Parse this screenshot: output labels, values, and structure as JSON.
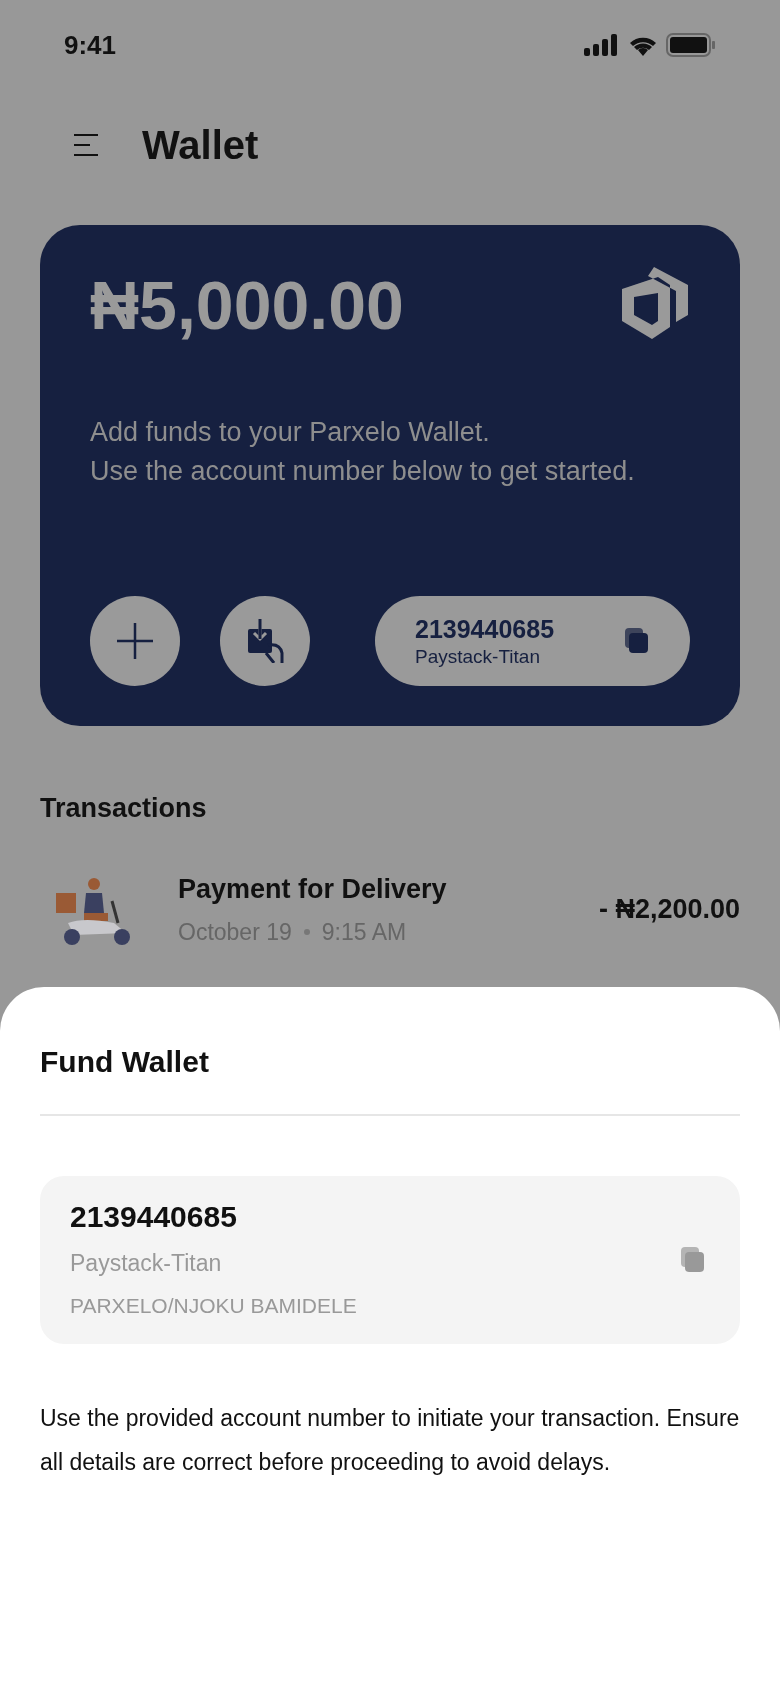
{
  "status_bar": {
    "time": "9:41"
  },
  "header": {
    "title": "Wallet"
  },
  "balance_card": {
    "balance": "₦5,000.00",
    "message": [
      "Add funds to your Parxelo Wallet.",
      "Use the account number below to get started."
    ],
    "account_number": "2139440685",
    "bank": "Paystack-Titan"
  },
  "transactions": {
    "title": "Transactions",
    "items": [
      {
        "title": "Payment for Delivery",
        "date": "October 19",
        "time": "9:15 AM",
        "amount": "- ₦2,200.00"
      }
    ]
  },
  "sheet": {
    "title": "Fund Wallet",
    "account_number": "2139440685",
    "bank": "Paystack-Titan",
    "account_name": "PARXELO/NJOKU BAMIDELE",
    "note": "Use the provided account number to initiate your transaction. Ensure all details are correct before proceeding to avoid delays."
  }
}
